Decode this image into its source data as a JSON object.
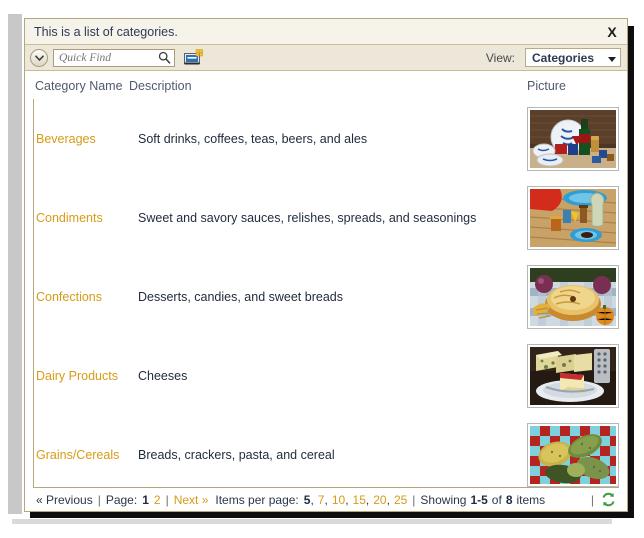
{
  "window": {
    "title": "This is a list of categories.",
    "close_label": "X"
  },
  "toolbar": {
    "quick_find_placeholder": "Quick Find",
    "quick_find_value": "",
    "chevron_icon": "chevron-down-icon",
    "search_icon": "search-icon",
    "new_record_icon": "new-record-icon",
    "view_label": "View:",
    "view_value": "Categories",
    "view_options": [
      "Categories"
    ],
    "view_caret_icon": "caret-down-icon"
  },
  "grid": {
    "columns": [
      "Category Name",
      "Description",
      "Picture"
    ],
    "rows": [
      {
        "name": "Beverages",
        "description": "Soft drinks, coffees, teas, beers, and ales",
        "picture": "beverages-thumbnail"
      },
      {
        "name": "Condiments",
        "description": "Sweet and savory sauces, relishes, spreads, and seasonings",
        "picture": "condiments-thumbnail"
      },
      {
        "name": "Confections",
        "description": "Desserts, candies, and sweet breads",
        "picture": "confections-thumbnail"
      },
      {
        "name": "Dairy Products",
        "description": "Cheeses",
        "picture": "dairy-products-thumbnail"
      },
      {
        "name": "Grains/Cereals",
        "description": "Breads, crackers, pasta, and cereal",
        "picture": "grains-cereals-thumbnail"
      }
    ]
  },
  "footer": {
    "previous_label": "« Previous",
    "page_label": "Page:",
    "pages": [
      "1",
      "2"
    ],
    "current_page": "1",
    "next_label": "Next »",
    "items_per_page_label": "Items per page:",
    "items_per_page_options": [
      "5",
      "7",
      "10",
      "15",
      "20",
      "25"
    ],
    "items_per_page_current": "5",
    "showing_prefix": "Showing",
    "showing_range": "1-5",
    "showing_middle": "of",
    "showing_total": "8",
    "showing_suffix": "items",
    "separator": "|",
    "refresh_icon": "refresh-icon"
  },
  "colors": {
    "link": "#d79b16",
    "text": "#1f2a3c",
    "border": "#b5a77d",
    "titlebar_bg": "#f6f3ea",
    "toolbar_bg": "#ece7d9"
  }
}
